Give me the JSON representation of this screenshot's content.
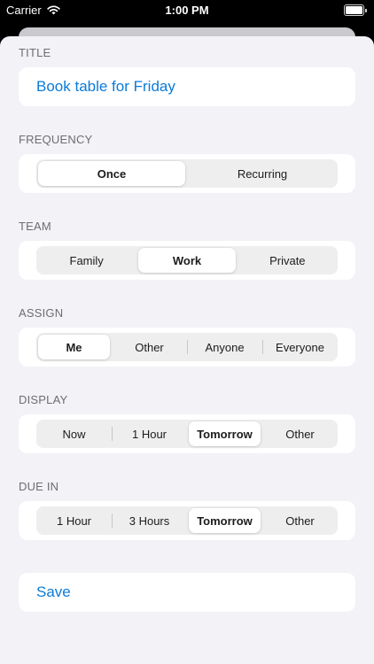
{
  "status_bar": {
    "carrier": "Carrier",
    "time": "1:00 PM",
    "wifi_icon": "wifi-icon",
    "battery_icon": "battery-icon"
  },
  "form": {
    "title": {
      "header": "TITLE",
      "value": "Book table for Friday"
    },
    "frequency": {
      "header": "FREQUENCY",
      "options": [
        "Once",
        "Recurring"
      ],
      "selected": "Once"
    },
    "team": {
      "header": "TEAM",
      "options": [
        "Family",
        "Work",
        "Private"
      ],
      "selected": "Work"
    },
    "assign": {
      "header": "ASSIGN",
      "options": [
        "Me",
        "Other",
        "Anyone",
        "Everyone"
      ],
      "selected": "Me"
    },
    "display": {
      "header": "DISPLAY",
      "options": [
        "Now",
        "1 Hour",
        "Tomorrow",
        "Other"
      ],
      "selected": "Tomorrow"
    },
    "due_in": {
      "header": "DUE IN",
      "options": [
        "1 Hour",
        "3 Hours",
        "Tomorrow",
        "Other"
      ],
      "selected": "Tomorrow"
    },
    "save_label": "Save"
  },
  "colors": {
    "accent": "#0a7bd8",
    "background": "#f2f2f7",
    "card": "#ffffff",
    "segment_track": "#eeeeef",
    "header_text": "#6d6d72"
  }
}
